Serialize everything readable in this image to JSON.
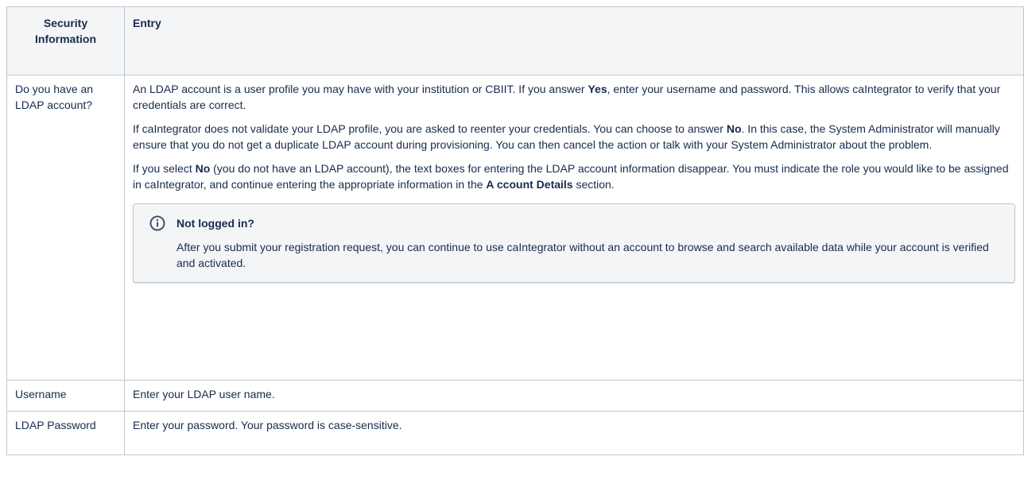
{
  "table": {
    "headers": [
      "Security Information",
      "Entry"
    ],
    "header_col1_line1": "Security",
    "header_col1_line2": "Information",
    "rows": [
      {
        "label": "Do you have an LDAP account?",
        "paragraphs": [
          {
            "p1a": "An LDAP account is a user profile you may have with your institution or CBIIT. If you answer ",
            "p1b": "Yes",
            "p1c": ", enter your username and password. This allows caIntegrator to verify that your credentials are correct."
          },
          {
            "p2a": "If caIntegrator does not validate your LDAP profile, you are asked to reenter your credentials. You can choose to answer ",
            "p2b": "No",
            "p2c": ". In this case, the System Administrator will manually ensure that you do not get a duplicate LDAP account during provisioning. You can then cancel the action or talk with your System Administrator about the problem."
          },
          {
            "p3a": "If you select ",
            "p3b": "No",
            "p3c": " (you do not have an LDAP account), the text boxes for entering the LDAP account information disappear. You must indicate the role you would like to be assigned in caIntegrator, and continue entering the appropriate information in the ",
            "p3d": "A ccount Details",
            "p3e": " section."
          }
        ],
        "panel": {
          "icon": "info-icon",
          "title": "Not logged in?",
          "body": "After you submit your registration request, you can continue to use caIntegrator without an account to browse and search available data while your account is verified and activated."
        }
      },
      {
        "label": "Username",
        "entry": "Enter your LDAP user name."
      },
      {
        "label": "LDAP Password",
        "entry": "Enter your password. Your password is case-sensitive."
      }
    ]
  }
}
